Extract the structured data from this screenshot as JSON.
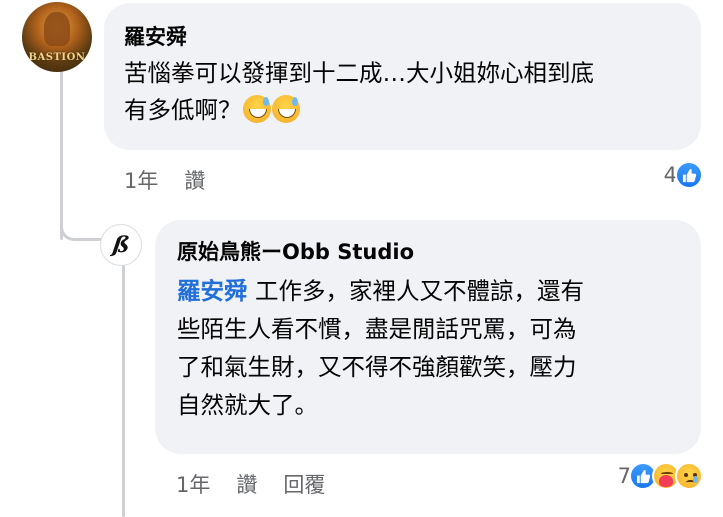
{
  "top_comment": {
    "author": "羅安舜",
    "text_line1": "苦惱拳可以發揮到十二成…大小姐妳心相到底",
    "text_line2": "有多低啊？",
    "emojis": [
      "sweat-smile-emoji",
      "sweat-smile-emoji"
    ],
    "avatar_logo_text": "BASTION",
    "time": "1年",
    "like_label": "讚",
    "reaction_count": "4",
    "reactions": [
      "like-icon"
    ]
  },
  "reply_comment": {
    "author": "原始鳥熊ーObb Studio",
    "mention": "羅安舜",
    "text_line1": " 工作多，家裡人又不體諒，還有",
    "text_line2": "些陌生人看不慣，盡是閒話咒罵，可為",
    "text_line3": "了和氣生財，又不得不強顏歡笑，壓力",
    "text_line4": "自然就大了。",
    "avatar_logo_text": "ß",
    "time": "1年",
    "like_label": "讚",
    "reply_label": "回覆",
    "reaction_count": "7",
    "reactions": [
      "like-icon",
      "care-icon",
      "sad-icon"
    ]
  },
  "colors": {
    "bubble": "#f0f2f5",
    "mention": "#216fdb",
    "like": "#1877f2",
    "meta_text": "#65676b"
  }
}
